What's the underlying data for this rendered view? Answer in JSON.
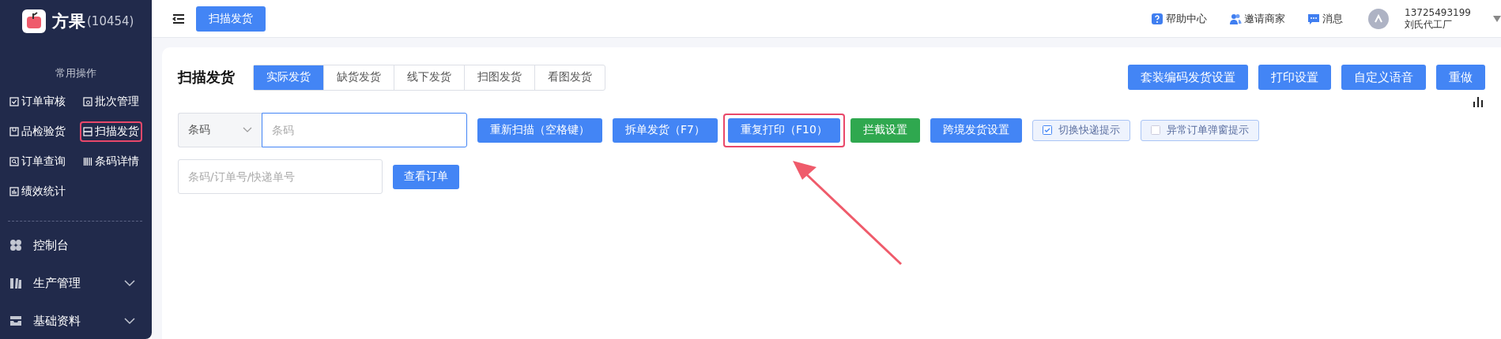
{
  "sidebar": {
    "logo": {
      "name": "方果",
      "count": "(10454)"
    },
    "quick_title": "常用操作",
    "quick_items": [
      {
        "label": "订单审核",
        "selected": false
      },
      {
        "label": "批次管理",
        "selected": false
      },
      {
        "label": "品检验货",
        "selected": false
      },
      {
        "label": "扫描发货",
        "selected": true
      },
      {
        "label": "订单查询",
        "selected": false
      },
      {
        "label": "条码详情",
        "selected": false
      },
      {
        "label": "绩效统计",
        "selected": false
      }
    ],
    "menu": [
      {
        "label": "控制台",
        "expandable": false
      },
      {
        "label": "生产管理",
        "expandable": true
      },
      {
        "label": "基础资料",
        "expandable": true
      }
    ]
  },
  "topbar": {
    "open_tab": "扫描发货",
    "links": [
      "帮助中心",
      "邀请商家",
      "消息"
    ],
    "user": {
      "phone": "13725493199",
      "company": "刘氏代工厂"
    }
  },
  "page": {
    "title": "扫描发货",
    "tabs": [
      {
        "label": "实际发货",
        "selected": true
      },
      {
        "label": "缺货发货",
        "selected": false
      },
      {
        "label": "线下发货",
        "selected": false
      },
      {
        "label": "扫图发货",
        "selected": false
      },
      {
        "label": "看图发货",
        "selected": false
      }
    ],
    "header_buttons": [
      "套装编码发货设置",
      "打印设置",
      "自定义语音",
      "重做"
    ],
    "scan": {
      "type_select": "条码",
      "placeholder": "条码"
    },
    "actions": [
      {
        "label": "重新扫描（空格键）",
        "kind": "primary",
        "highlighted": false
      },
      {
        "label": "拆单发货（F7）",
        "kind": "primary",
        "highlighted": false
      },
      {
        "label": "重复打印（F10）",
        "kind": "primary",
        "highlighted": true
      },
      {
        "label": "拦截设置",
        "kind": "success",
        "highlighted": false
      },
      {
        "label": "跨境发货设置",
        "kind": "primary",
        "highlighted": false
      },
      {
        "label": "切换快递提示",
        "kind": "checkbox",
        "checked": true
      },
      {
        "label": "异常订单弹窗提示",
        "kind": "checkbox",
        "checked": false
      }
    ],
    "lookup": {
      "placeholder": "条码/订单号/快递单号",
      "button": "查看订单"
    }
  }
}
